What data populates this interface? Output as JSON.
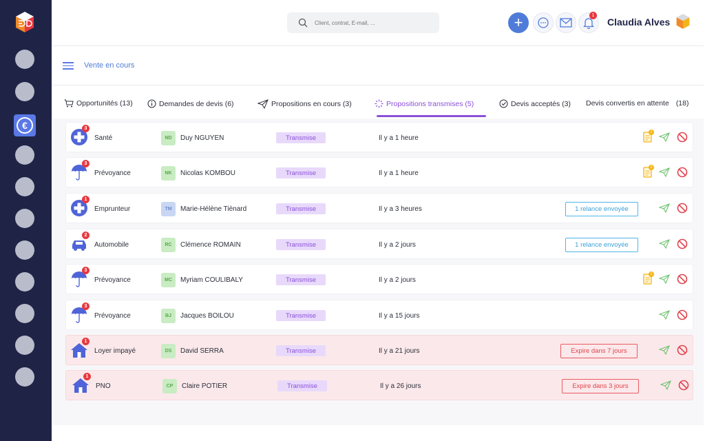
{
  "header": {
    "search_placeholder": "Client, contrat, E-mail, ...",
    "user_name": "Claudia Alves",
    "notification_count": "1"
  },
  "subheader": {
    "title": "Vente en cours"
  },
  "tabs": [
    {
      "label": "Opportunités (13)",
      "icon": "cart-icon"
    },
    {
      "label": "Demandes de devis (6)",
      "icon": "info-icon"
    },
    {
      "label": "Propositions en cours (3)",
      "icon": "send-icon"
    },
    {
      "label": "Propositions transmises (5)",
      "icon": "loader-icon",
      "active": true
    },
    {
      "label": "Devis acceptés (3)",
      "icon": "check-icon"
    },
    {
      "label": "Devis convertis en attente",
      "count": "(18)"
    }
  ],
  "rows": [
    {
      "product": "Santé",
      "icon": "health-cross-icon",
      "badge": "3",
      "initials": "ND",
      "client": "Duy NGUYEN",
      "avatar_color": "green",
      "status": "Transmise",
      "time": "Il y a 1 heure",
      "tag": "",
      "tag_type": "",
      "doc": true,
      "doc_badge": "1",
      "alert": false
    },
    {
      "product": "Prévoyance",
      "icon": "umbrella-icon",
      "badge": "3",
      "initials": "NK",
      "client": "Nicolas KOMBOU",
      "avatar_color": "green",
      "status": "Transmise",
      "time": "Il y a 1 heure",
      "tag": "",
      "tag_type": "",
      "doc": true,
      "doc_badge": "2",
      "alert": false
    },
    {
      "product": "Emprunteur",
      "icon": "health-cross-icon",
      "badge": "1",
      "initials": "TM",
      "client": "Marie-Hélène Tiènard",
      "avatar_color": "blue",
      "status": "Transmise",
      "time": "Il y a 3 heures",
      "tag": "1 relance envoyée",
      "tag_type": "blue",
      "doc": false,
      "doc_badge": "",
      "alert": false
    },
    {
      "product": "Automobile",
      "icon": "car-icon",
      "badge": "2",
      "initials": "RC",
      "client": "Clémence ROMAIN",
      "avatar_color": "green",
      "status": "Transmise",
      "time": "Il y a 2 jours",
      "tag": "1 relance envoyée",
      "tag_type": "blue",
      "doc": false,
      "doc_badge": "",
      "alert": false
    },
    {
      "product": "Prévoyance",
      "icon": "umbrella-icon",
      "badge": "3",
      "initials": "MC",
      "client": "Myriam COULIBALY",
      "avatar_color": "green",
      "status": "Transmise",
      "time": "Il y a 2 jours",
      "tag": "",
      "tag_type": "",
      "doc": true,
      "doc_badge": "1",
      "alert": false
    },
    {
      "product": "Prévoyance",
      "icon": "umbrella-icon",
      "badge": "3",
      "initials": "BJ",
      "client": "Jacques BOILOU",
      "avatar_color": "green",
      "status": "Transmise",
      "time": "Il y a 15 jours",
      "tag": "",
      "tag_type": "",
      "doc": false,
      "doc_badge": "",
      "alert": false
    },
    {
      "product": "Loyer impayé",
      "icon": "house-icon",
      "badge": "1",
      "initials": "DS",
      "client": "David SERRA",
      "avatar_color": "green",
      "status": "Transmise",
      "time": "Il y a 21 jours",
      "tag": "Expire dans 7 jours",
      "tag_type": "red",
      "doc": false,
      "doc_badge": "",
      "alert": true
    },
    {
      "product": "PNO",
      "icon": "house-icon",
      "badge": "1",
      "initials": "CP",
      "client": "Claire POTIER",
      "avatar_color": "green",
      "status": "Transmise",
      "time": "Il y a 26 jours",
      "tag": "Expire dans 3 jours",
      "tag_type": "red",
      "doc": false,
      "doc_badge": "",
      "alert": true
    }
  ],
  "colors": {
    "sidebar": "#1f2447",
    "accent_blue": "#4f7cd8",
    "accent_purple": "#8b4fd9",
    "alert_bg": "#fbe8ea"
  }
}
